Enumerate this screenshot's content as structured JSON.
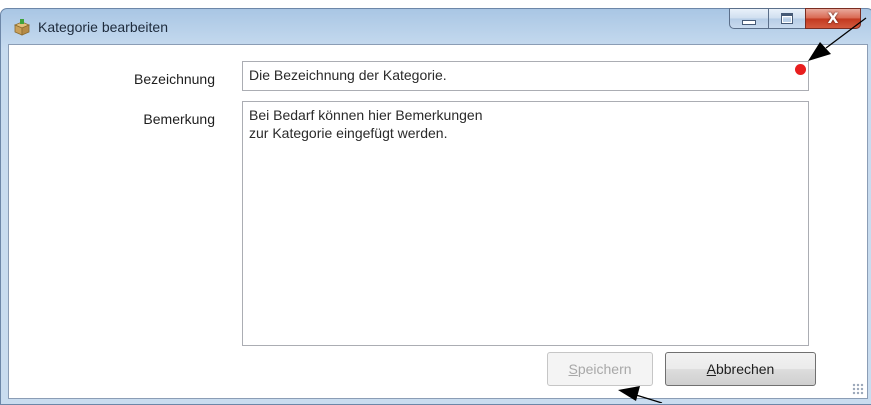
{
  "window": {
    "title": "Kategorie bearbeiten",
    "icon": "box-icon",
    "controls": {
      "minimize": "minimize-icon",
      "maximize": "maximize-icon",
      "close": "X"
    }
  },
  "form": {
    "bezeichnung_label": "Bezeichnung",
    "bezeichnung_value": "Die Bezeichnung der Kategorie.",
    "bemerkung_label": "Bemerkung",
    "bemerkung_value": "Bei Bedarf können hier Bemerkungen\nzur Kategorie eingefügt werden.",
    "validation_color": "#e81e1e"
  },
  "buttons": {
    "save_mnemonic": "S",
    "save_rest": "peichern",
    "cancel_mnemonic": "A",
    "cancel_rest": "bbrechen"
  }
}
